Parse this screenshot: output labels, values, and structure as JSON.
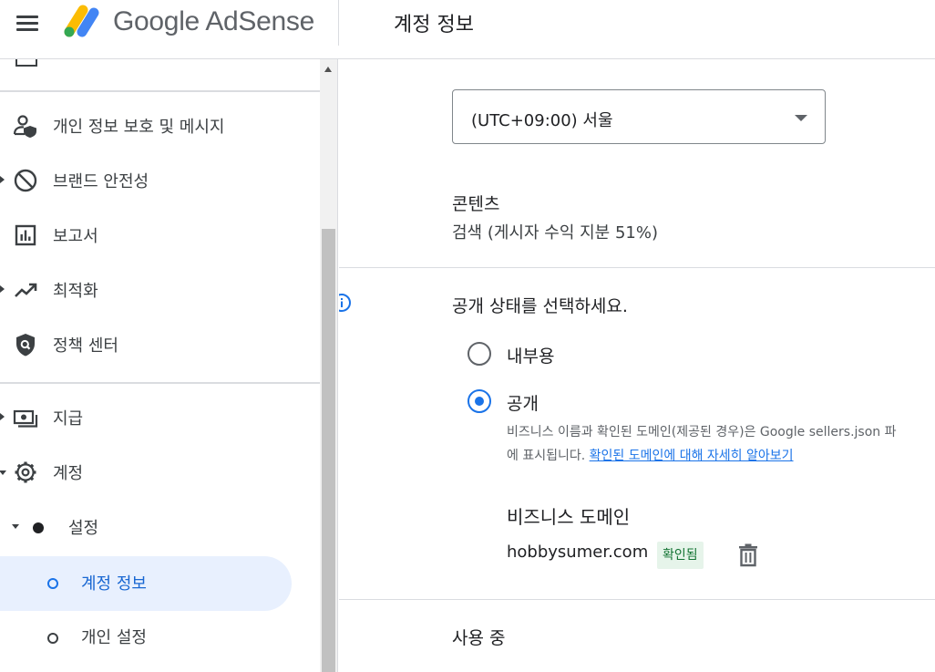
{
  "header": {
    "app_name": "Google AdSense",
    "page_title": "계정 정보"
  },
  "sidebar": {
    "items": [
      {
        "label": "개인 정보 보호 및 메시지",
        "icon": "person-shield-icon"
      },
      {
        "label": "브랜드 안전성",
        "icon": "block-icon"
      },
      {
        "label": "보고서",
        "icon": "bar-chart-icon"
      },
      {
        "label": "최적화",
        "icon": "trending-up-icon"
      },
      {
        "label": "정책 센터",
        "icon": "shield-search-icon"
      },
      {
        "label": "지급",
        "icon": "payments-icon"
      },
      {
        "label": "계정",
        "icon": "gear-icon"
      }
    ],
    "sub_item": {
      "label": "설정"
    },
    "leaf_items": [
      {
        "label": "계정 정보",
        "active": true
      },
      {
        "label": "개인 설정",
        "active": false
      }
    ]
  },
  "main": {
    "timezone": {
      "value": "(UTC+09:00) 서울"
    },
    "content": {
      "label": "콘텐츠",
      "value": "검색 (게시자 수익 지분 51%)"
    },
    "visibility": {
      "prompt": "공개 상태를 선택하세요.",
      "options": [
        {
          "label": "내부용",
          "selected": false
        },
        {
          "label": "공개",
          "selected": true
        }
      ],
      "description_line1": "비즈니스 이름과 확인된 도메인(제공된 경우)은 Google sellers.json 파",
      "description_line2": "에 표시됩니다.",
      "link_text": "확인된 도메인에 대해 자세히 알아보기"
    },
    "business_domain": {
      "heading": "비즈니스 도메인",
      "domain": "hobbysumer.com",
      "status": "확인됨"
    },
    "in_use": {
      "label": "사용 중"
    }
  },
  "colors": {
    "accent": "#1a73e8",
    "active_bg": "#e8f0fe",
    "verified_bg": "#e6f4ea",
    "verified_text": "#137333"
  }
}
